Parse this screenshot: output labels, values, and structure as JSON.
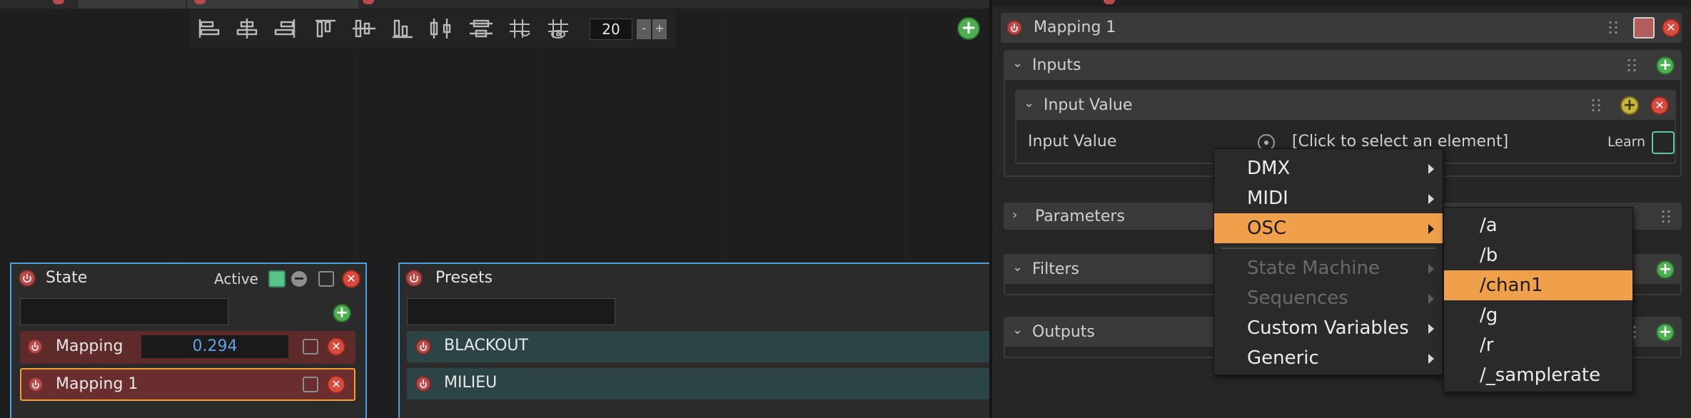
{
  "toolbar": {
    "icons": [
      "align-left-icon",
      "align-center-h-icon",
      "align-right-icon",
      "align-top-icon",
      "align-middle-v-icon",
      "align-bottom-icon",
      "distribute-h-icon",
      "distribute-v-icon",
      "snap-grid-icon",
      "show-grid-icon"
    ],
    "grid_size": "20",
    "decrease_label": "-",
    "increase_label": "+"
  },
  "state_panel": {
    "title": "State",
    "active_label": "Active",
    "search_value": "",
    "rows": [
      {
        "label": "Mapping",
        "value": "0.294"
      },
      {
        "label": "Mapping 1"
      }
    ]
  },
  "presets_panel": {
    "title": "Presets",
    "search_value": "",
    "rows": [
      {
        "label": "BLACKOUT"
      },
      {
        "label": "MILIEU"
      }
    ]
  },
  "inspector": {
    "title": "Mapping 1",
    "inputs": {
      "label": "Inputs",
      "input_value": {
        "header": "Input Value",
        "row_label": "Input Value",
        "target_placeholder": "[Click to select an element]",
        "learn_label": "Learn"
      }
    },
    "parameters_label": "Parameters",
    "filters_label": "Filters",
    "outputs_label": "Outputs"
  },
  "context_menu": {
    "items": [
      {
        "label": "DMX",
        "enabled": true,
        "submenu": true
      },
      {
        "label": "MIDI",
        "enabled": true,
        "submenu": true
      },
      {
        "label": "OSC",
        "enabled": true,
        "submenu": true,
        "highlighted": true
      },
      {
        "label": "State Machine",
        "enabled": false,
        "submenu": true
      },
      {
        "label": "Sequences",
        "enabled": false,
        "submenu": true
      },
      {
        "label": "Custom Variables",
        "enabled": true,
        "submenu": true
      },
      {
        "label": "Generic",
        "enabled": true,
        "submenu": true
      }
    ],
    "osc_submenu": [
      "/a",
      "/b",
      "/chan1",
      "/g",
      "/r",
      "/_samplerate"
    ],
    "osc_highlighted": "/chan1"
  },
  "colors": {
    "accent_orange": "#f0a04a",
    "selection_blue": "#4aa3df",
    "add_green": "#4caf50",
    "remove_red": "#d84a3a"
  }
}
